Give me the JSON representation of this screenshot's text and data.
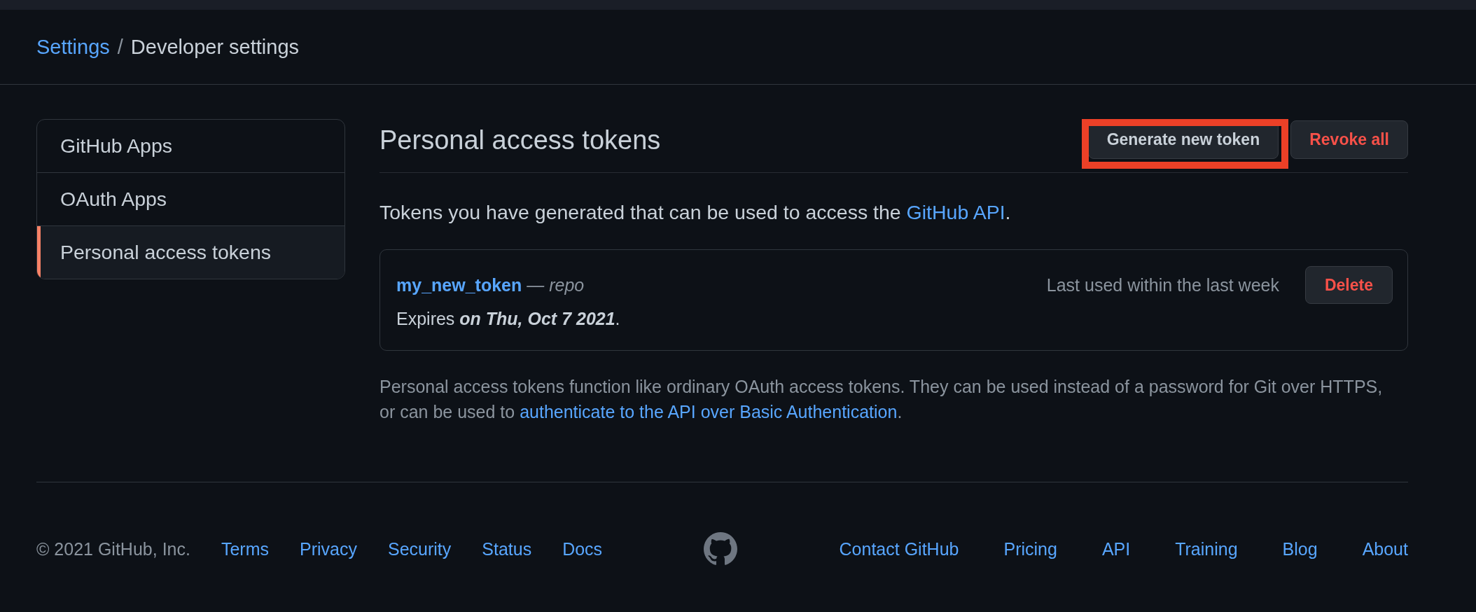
{
  "breadcrumb": {
    "items": [
      {
        "label": "Settings",
        "kind": "link"
      },
      {
        "label": "Developer settings",
        "kind": "current"
      }
    ],
    "separator": "/"
  },
  "sidebar": {
    "items": [
      {
        "label": "GitHub Apps",
        "selected": false
      },
      {
        "label": "OAuth Apps",
        "selected": false
      },
      {
        "label": "Personal access tokens",
        "selected": true
      }
    ]
  },
  "header": {
    "title": "Personal access tokens",
    "buttons": [
      {
        "label": "Generate new token",
        "kind": "default",
        "highlighted": true
      },
      {
        "label": "Revoke all",
        "kind": "danger",
        "highlighted": false
      }
    ]
  },
  "intro": {
    "text": "Tokens you have generated that can be used to access the ",
    "link": "GitHub API",
    "after": "."
  },
  "tokens": [
    {
      "name": "my_new_token",
      "scopes": "— repo",
      "last_used": "Last used within the last week",
      "expires": "Expires **on Thu, Oct 7 2021**.",
      "action": "Delete"
    }
  ],
  "note": {
    "text": "Personal access tokens function like ordinary OAuth access tokens. They can be used instead of a password for Git over HTTPS, or can be used to ",
    "link": "authenticate to the API over Basic Authentication",
    "after": "."
  },
  "footer": {
    "copyright": "© 2021 GitHub, Inc.",
    "left_links": [
      "Terms",
      "Privacy",
      "Security",
      "Status",
      "Docs"
    ],
    "right_links": [
      "Contact GitHub",
      "Pricing",
      "API",
      "Training",
      "Blog",
      "About"
    ]
  }
}
